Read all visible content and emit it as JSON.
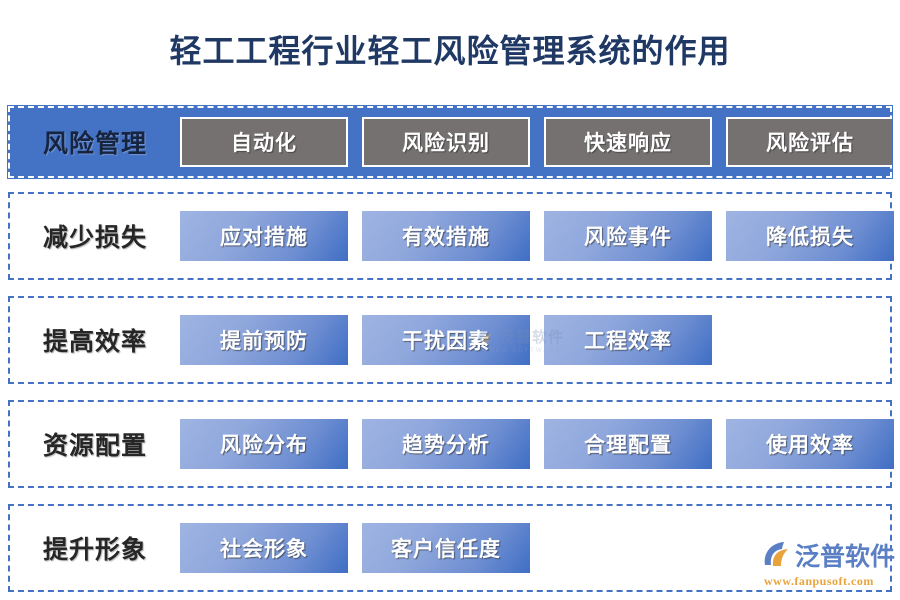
{
  "page": {
    "title": "轻工工程行业轻工风险管理系统的作用",
    "background_color": "#ffffff",
    "title_color": "#1f3864",
    "accent_color": "#4472c4",
    "gray_chip_color": "#767171"
  },
  "rows": [
    {
      "label": "风险管理",
      "style": "header",
      "chips": [
        "自动化",
        "风险识别",
        "快速响应",
        "风险评估"
      ]
    },
    {
      "label": "减少损失",
      "style": "plain",
      "chips": [
        "应对措施",
        "有效措施",
        "风险事件",
        "降低损失"
      ]
    },
    {
      "label": "提高效率",
      "style": "plain",
      "chips": [
        "提前预防",
        "干扰因素",
        "工程效率"
      ]
    },
    {
      "label": "资源配置",
      "style": "plain",
      "chips": [
        "风险分布",
        "趋势分析",
        "合理配置",
        "使用效率"
      ]
    },
    {
      "label": "提升形象",
      "style": "plain",
      "chips": [
        "社会形象",
        "客户信任度"
      ]
    }
  ],
  "watermark": {
    "brand": "泛普软件",
    "sub": "FANPU SOFTWARE"
  },
  "logo": {
    "name": "泛普软件",
    "url": "www.fanpusoft.com",
    "icon": "fanpu-swoosh-logo-icon"
  }
}
